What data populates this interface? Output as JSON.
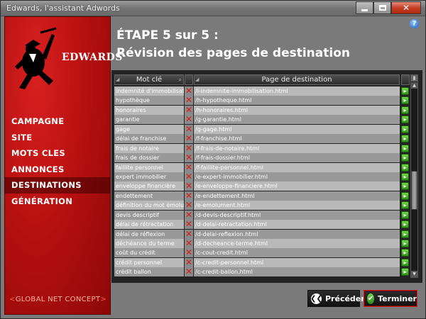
{
  "window": {
    "title": "Edwards, l'assistant Adwords"
  },
  "logo": {
    "text": "EDWARDS"
  },
  "sidebar": {
    "items": [
      {
        "label": "CAMPAGNE",
        "active": false
      },
      {
        "label": "SITE",
        "active": false
      },
      {
        "label": "MOTS CLES",
        "active": false
      },
      {
        "label": "ANNONCES",
        "active": false
      },
      {
        "label": "DESTINATIONS",
        "active": true
      },
      {
        "label": "GÉNÉRATION",
        "active": false
      }
    ],
    "brand": {
      "prefix": "<",
      "name": "GLOBAL NET CONCEPT",
      "suffix": ">"
    }
  },
  "header": {
    "step": "ÉTAPE 5 sur 5 :",
    "title": "Révision des pages de destination"
  },
  "table": {
    "columns": {
      "keyword": "Mot clé",
      "page": "Page de destination"
    },
    "rows": [
      {
        "keyword": "indemnité d'immobilisation",
        "page": "/i-indemnite-immobilisation.html"
      },
      {
        "keyword": "hypothèque",
        "page": "/h-hypotheque.html"
      },
      {
        "keyword": "honoraires",
        "page": "/h-honoraires.html"
      },
      {
        "keyword": "garantie",
        "page": "/g-garantie.html"
      },
      {
        "keyword": "gage",
        "page": "/g-gage.html"
      },
      {
        "keyword": "délai de franchise",
        "page": "/f-franchise.html"
      },
      {
        "keyword": "frais de notaire",
        "page": "/f-frais-de-notaire.html"
      },
      {
        "keyword": "frais de dossier",
        "page": "/f-frais-dossier.html"
      },
      {
        "keyword": "faillite personnel",
        "page": "/f-faillite-personnel.html"
      },
      {
        "keyword": "expert immobilier",
        "page": "/e-expert-immobilier.html"
      },
      {
        "keyword": "enveloppe financière",
        "page": "/e-enveloppe-financiere.html"
      },
      {
        "keyword": "endettement",
        "page": "/e-endettement.html"
      },
      {
        "keyword": "définition du mot émolument",
        "page": "/e-emolument.html"
      },
      {
        "keyword": "devis descriptif",
        "page": "/d-devis-descriptif.html"
      },
      {
        "keyword": "délai de rétractation",
        "page": "/d-delai-retractation.html"
      },
      {
        "keyword": "délai de réflexion",
        "page": "/d-delai-reflexion.html"
      },
      {
        "keyword": "déchéance du terme",
        "page": "/d-decheance-terme.html"
      },
      {
        "keyword": "coût du crédit",
        "page": "/c-cout-credit.html"
      },
      {
        "keyword": "crédit personnel",
        "page": "/c-credit-personnel.html"
      },
      {
        "keyword": "crédit ballon",
        "page": "/c-credit-ballon.html"
      }
    ]
  },
  "buttons": {
    "previous": "Précédent",
    "finish": "Terminer"
  },
  "colors": {
    "sidebar_red": "#b81010",
    "panel_gray": "#7a7a7a",
    "delete_red": "#e01818",
    "go_green": "#3aa020"
  }
}
